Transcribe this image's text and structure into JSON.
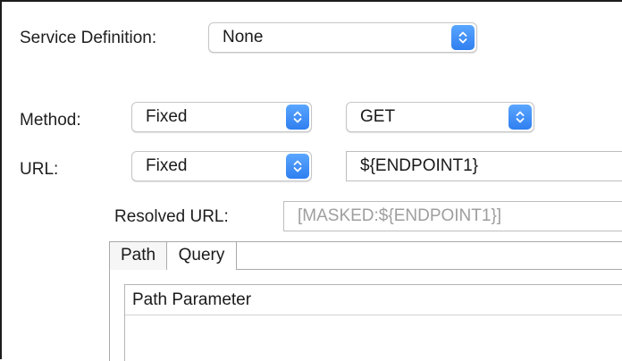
{
  "service_definition": {
    "label": "Service Definition:",
    "value": "None"
  },
  "method": {
    "label": "Method:",
    "mode": "Fixed",
    "value": "GET"
  },
  "url": {
    "label": "URL:",
    "mode": "Fixed",
    "value": "${ENDPOINT1}"
  },
  "resolved_url": {
    "label": "Resolved URL:",
    "value": "[MASKED:${ENDPOINT1}]"
  },
  "tabs": [
    {
      "label": "Path",
      "active": true
    },
    {
      "label": "Query",
      "active": false
    }
  ],
  "path_table": {
    "columns": [
      "Path Parameter"
    ]
  },
  "colors": {
    "accent": "#2f7ff0",
    "border": "#a9a9a9",
    "disabled_text": "#9e9e9e"
  },
  "icons": {
    "stepper": "chevron-up-down-icon"
  }
}
